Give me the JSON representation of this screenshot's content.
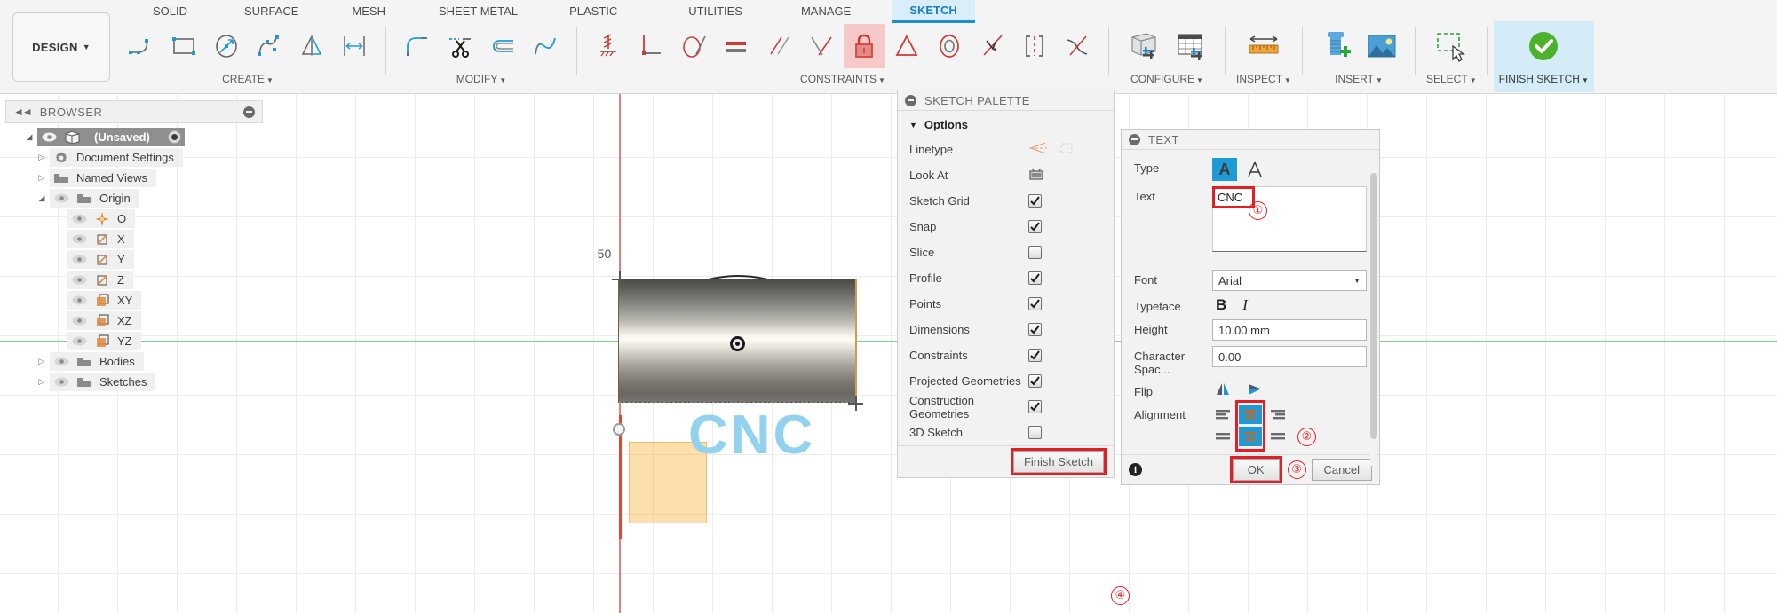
{
  "ribbon": {
    "design_label": "DESIGN",
    "tabs": [
      {
        "label": "SOLID",
        "active": false
      },
      {
        "label": "SURFACE",
        "active": false
      },
      {
        "label": "MESH",
        "active": false
      },
      {
        "label": "SHEET METAL",
        "active": false
      },
      {
        "label": "PLASTIC",
        "active": false
      },
      {
        "label": "UTILITIES",
        "active": false
      },
      {
        "label": "MANAGE",
        "active": false
      },
      {
        "label": "SKETCH",
        "active": true
      }
    ],
    "panels": [
      {
        "label": "CREATE",
        "has_caret": true
      },
      {
        "label": "MODIFY",
        "has_caret": true
      },
      {
        "label": "CONSTRAINTS",
        "has_caret": true
      },
      {
        "label": "CONFIGURE",
        "has_caret": true
      },
      {
        "label": "INSPECT",
        "has_caret": true
      },
      {
        "label": "INSERT",
        "has_caret": true
      },
      {
        "label": "SELECT",
        "has_caret": true
      },
      {
        "label": "FINISH SKETCH",
        "has_caret": true
      }
    ],
    "accent_blue": "#1a8fd1",
    "finish_bg": "#d4ecf8"
  },
  "browser": {
    "title": "BROWSER",
    "collapse_icon": "double-chevron-left-icon",
    "minimize_icon": "minus-circle-icon",
    "items": [
      {
        "label": "(Unsaved)",
        "depth": 0,
        "twist": "down",
        "eye": true,
        "icon": "component-icon",
        "radio": true,
        "selected": true
      },
      {
        "label": "Document Settings",
        "depth": 1,
        "twist": "right",
        "eye": false,
        "icon": "gear-icon"
      },
      {
        "label": "Named Views",
        "depth": 1,
        "twist": "right",
        "eye": false,
        "icon": "folder-icon"
      },
      {
        "label": "Origin",
        "depth": 1,
        "twist": "down",
        "eye": true,
        "icon": "folder-icon"
      },
      {
        "label": "O",
        "depth": 2,
        "twist": "none",
        "eye": true,
        "icon": "origin-point-icon"
      },
      {
        "label": "X",
        "depth": 2,
        "twist": "none",
        "eye": true,
        "icon": "axis-icon"
      },
      {
        "label": "Y",
        "depth": 2,
        "twist": "none",
        "eye": true,
        "icon": "axis-icon"
      },
      {
        "label": "Z",
        "depth": 2,
        "twist": "none",
        "eye": true,
        "icon": "axis-icon"
      },
      {
        "label": "XY",
        "depth": 2,
        "twist": "none",
        "eye": true,
        "icon": "plane-icon"
      },
      {
        "label": "XZ",
        "depth": 2,
        "twist": "none",
        "eye": true,
        "icon": "plane-icon"
      },
      {
        "label": "YZ",
        "depth": 2,
        "twist": "none",
        "eye": true,
        "icon": "plane-icon"
      },
      {
        "label": "Bodies",
        "depth": 1,
        "twist": "right",
        "eye": true,
        "icon": "folder-icon"
      },
      {
        "label": "Sketches",
        "depth": 1,
        "twist": "right",
        "eye": true,
        "icon": "folder-icon"
      }
    ]
  },
  "palette": {
    "title": "SKETCH PALETTE",
    "section": "Options",
    "rows": [
      {
        "name": "Linetype",
        "control": "linetype-icons"
      },
      {
        "name": "Look At",
        "control": "lookat-icon"
      },
      {
        "name": "Sketch Grid",
        "control": "checkbox",
        "checked": true
      },
      {
        "name": "Snap",
        "control": "checkbox",
        "checked": true
      },
      {
        "name": "Slice",
        "control": "checkbox",
        "checked": false
      },
      {
        "name": "Profile",
        "control": "checkbox",
        "checked": true
      },
      {
        "name": "Points",
        "control": "checkbox",
        "checked": true
      },
      {
        "name": "Dimensions",
        "control": "checkbox",
        "checked": true
      },
      {
        "name": "Constraints",
        "control": "checkbox",
        "checked": true
      },
      {
        "name": "Projected Geometries",
        "control": "checkbox",
        "checked": true
      },
      {
        "name": "Construction Geometries",
        "control": "checkbox",
        "checked": true
      },
      {
        "name": "3D Sketch",
        "control": "checkbox",
        "checked": false
      }
    ],
    "finish_button": "Finish Sketch",
    "finish_annotation": "④"
  },
  "text_dialog": {
    "title": "TEXT",
    "type_label": "Type",
    "type_options": [
      "text-solid-icon",
      "text-outline-icon"
    ],
    "type_selected_index": 0,
    "text_label": "Text",
    "text_value": "CNC",
    "text_annotation": "①",
    "font_label": "Font",
    "font_value": "Arial",
    "typeface_label": "Typeface",
    "typeface_bold": "B",
    "typeface_italic": "I",
    "height_label": "Height",
    "height_value": "10.00 mm",
    "char_spacing_label": "Character Spac...",
    "char_spacing_value": "0.00",
    "flip_label": "Flip",
    "flip_options": [
      "flip-horizontal-icon",
      "flip-vertical-icon"
    ],
    "alignment_label": "Alignment",
    "alignment_annotation": "②",
    "ok_label": "OK",
    "ok_annotation": "③",
    "cancel_label": "Cancel",
    "info_icon": "info-icon"
  },
  "viewport": {
    "axis_label": "-50",
    "sketch_text": "CNC",
    "sketch_text_color": "#93d2ef",
    "x_axis_color": "#7fd87f",
    "y_axis_color": "#e8462b",
    "highlight_color": "#f7b23c"
  }
}
